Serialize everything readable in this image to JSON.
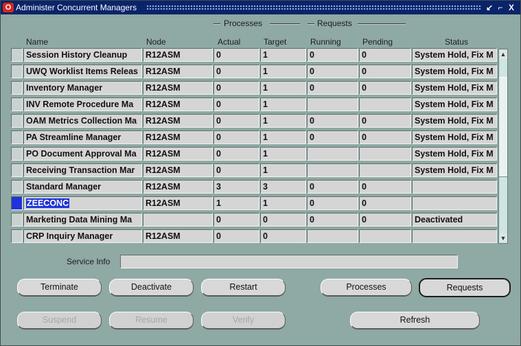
{
  "window": {
    "title": "Administer Concurrent Managers",
    "controls": [
      "↙",
      "⌐",
      "X"
    ]
  },
  "group_headers": {
    "processes": "Processes",
    "requests": "Requests"
  },
  "columns": {
    "name": "Name",
    "node": "Node",
    "actual": "Actual",
    "target": "Target",
    "running": "Running",
    "pending": "Pending",
    "status": "Status"
  },
  "rows": [
    {
      "name": "Session History Cleanup",
      "node": "R12ASM",
      "actual": "0",
      "target": "1",
      "running": "0",
      "pending": "0",
      "status": "System Hold, Fix M"
    },
    {
      "name": "UWQ Worklist Items Releas",
      "node": "R12ASM",
      "actual": "0",
      "target": "1",
      "running": "0",
      "pending": "0",
      "status": "System Hold, Fix M"
    },
    {
      "name": "Inventory Manager",
      "node": "R12ASM",
      "actual": "0",
      "target": "1",
      "running": "0",
      "pending": "0",
      "status": "System Hold, Fix M"
    },
    {
      "name": "INV Remote Procedure Ma",
      "node": "R12ASM",
      "actual": "0",
      "target": "1",
      "running": "",
      "pending": "",
      "status": "System Hold, Fix M"
    },
    {
      "name": "OAM Metrics Collection Ma",
      "node": "R12ASM",
      "actual": "0",
      "target": "1",
      "running": "0",
      "pending": "0",
      "status": "System Hold, Fix M"
    },
    {
      "name": "PA Streamline Manager",
      "node": "R12ASM",
      "actual": "0",
      "target": "1",
      "running": "0",
      "pending": "0",
      "status": "System Hold, Fix M"
    },
    {
      "name": "PO Document Approval Ma",
      "node": "R12ASM",
      "actual": "0",
      "target": "1",
      "running": "",
      "pending": "",
      "status": "System Hold, Fix M"
    },
    {
      "name": "Receiving Transaction Mar",
      "node": "R12ASM",
      "actual": "0",
      "target": "1",
      "running": "",
      "pending": "",
      "status": "System Hold, Fix M"
    },
    {
      "name": "Standard Manager",
      "node": "R12ASM",
      "actual": "3",
      "target": "3",
      "running": "0",
      "pending": "0",
      "status": ""
    },
    {
      "name": "ZEECONC",
      "node": "R12ASM",
      "actual": "1",
      "target": "1",
      "running": "0",
      "pending": "0",
      "status": "",
      "selected": true
    },
    {
      "name": "Marketing Data Mining Ma",
      "node": "",
      "actual": "0",
      "target": "0",
      "running": "0",
      "pending": "0",
      "status": "Deactivated"
    },
    {
      "name": "CRP Inquiry Manager",
      "node": "R12ASM",
      "actual": "0",
      "target": "0",
      "running": "",
      "pending": "",
      "status": ""
    }
  ],
  "service_info": {
    "label": "Service Info",
    "value": ""
  },
  "buttons": {
    "terminate": "Terminate",
    "deactivate": "Deactivate",
    "restart": "Restart",
    "processes": "Processes",
    "requests": "Requests",
    "suspend": "Suspend",
    "resume": "Resume",
    "verify": "Verify",
    "refresh": "Refresh"
  }
}
